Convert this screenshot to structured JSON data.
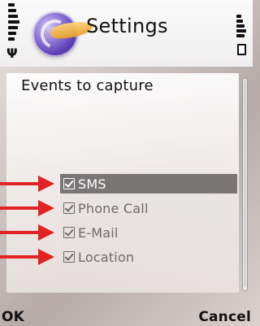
{
  "header": {
    "title": "Settings",
    "logo_icon": "app-logo-icon"
  },
  "status": {
    "signal_icon": "signal-strength-icon",
    "battery_icon": "battery-icon"
  },
  "panel": {
    "heading": "Events to capture"
  },
  "options": [
    {
      "label": "SMS",
      "checked": true,
      "selected": true
    },
    {
      "label": "Phone Call",
      "checked": true,
      "selected": false
    },
    {
      "label": "E-Mail",
      "checked": true,
      "selected": false
    },
    {
      "label": "Location",
      "checked": true,
      "selected": false
    }
  ],
  "softkeys": {
    "left": "OK",
    "right": "Cancel"
  },
  "colors": {
    "selection": "#7a7676",
    "arrow": "#e12323"
  }
}
